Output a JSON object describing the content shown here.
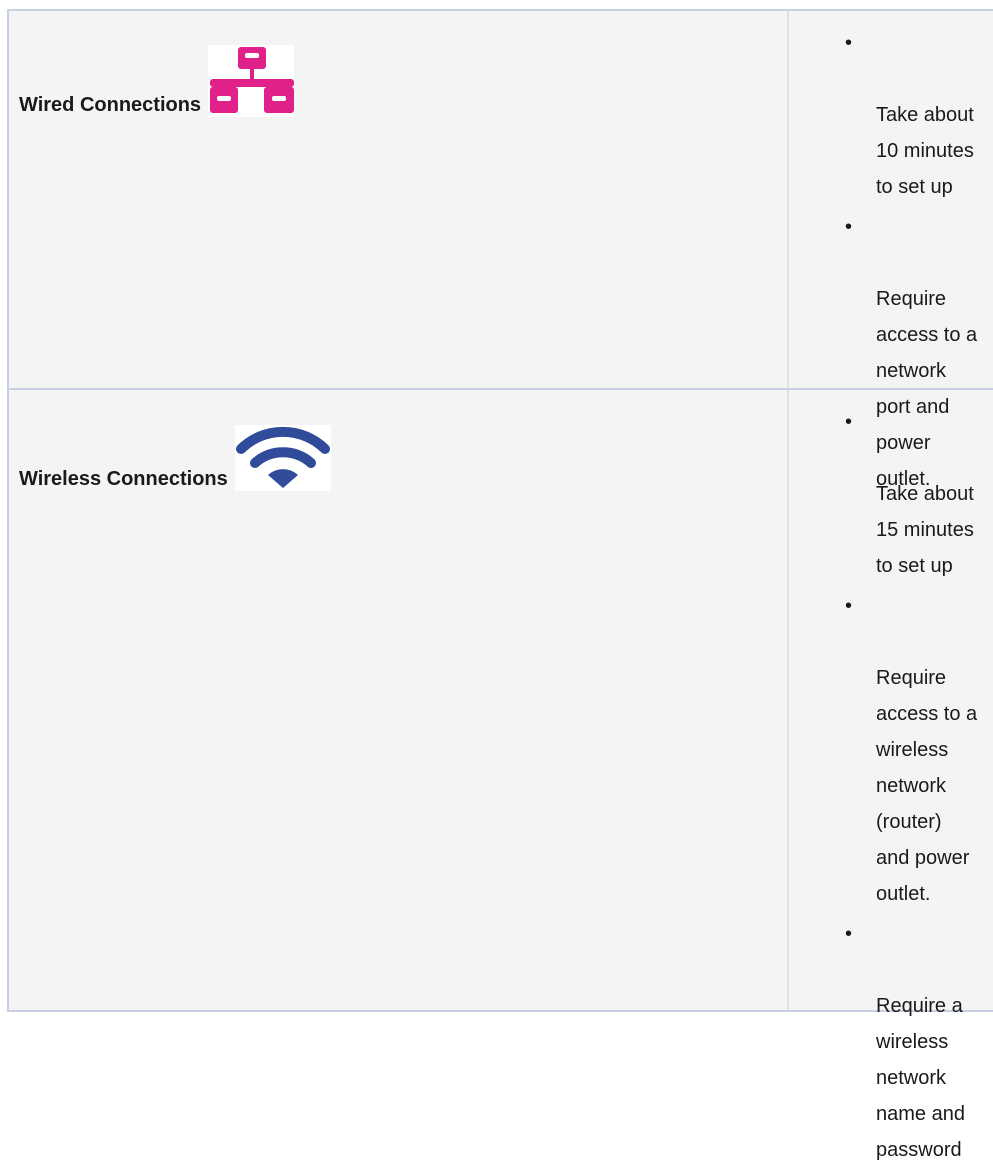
{
  "rows": [
    {
      "label": "Wired Connections",
      "icon": "network-icon",
      "icon_color": "#e0218a",
      "bullets": [
        "Take about\n10 minutes\nto set up",
        "Require\naccess to a\nnetwork\nport and\npower\noutlet."
      ]
    },
    {
      "label": "Wireless Connections",
      "icon": "wifi-icon",
      "icon_color": "#2f4b9a",
      "bullets": [
        "Take about\n15 minutes\nto set up",
        "Require\naccess to a\nwireless\nnetwork\n(router)\nand power\noutlet.",
        "Require a\nwireless\nnetwork\nname and\npassword"
      ]
    }
  ],
  "bullet_glyph": "•"
}
